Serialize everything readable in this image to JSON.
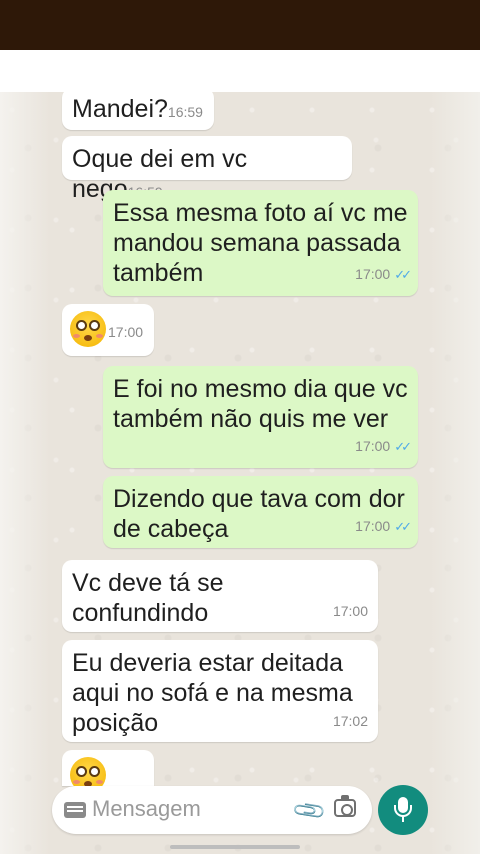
{
  "messages": [
    {
      "text": "Mandei?",
      "time": "16:59"
    },
    {
      "text": "Oque dei em vc nego",
      "time": "16:59"
    },
    {
      "line1": "Essa mesma foto aí vc me",
      "line2": "mandou semana passada",
      "line3": "também",
      "time": "17:00",
      "status": "✓✓"
    },
    {
      "emoji": "flushed-face",
      "time": "17:00"
    },
    {
      "line1": "E foi no mesmo dia que vc",
      "line2": "também não quis me ver",
      "time": "17:00",
      "status": "✓✓"
    },
    {
      "line1": "Dizendo que tava com dor",
      "line2": "de cabeça",
      "time": "17:00",
      "status": "✓✓"
    },
    {
      "line1": "Vc deve tá se",
      "line2": "confundindo",
      "time": "17:00"
    },
    {
      "line1": "Eu deveria estar deitada",
      "line2": "aqui no sofá e na mesma",
      "line3": "posição",
      "time": "17:02"
    },
    {
      "emoji": "flushed-face"
    }
  ],
  "composer": {
    "placeholder": "Mensagem"
  },
  "colors": {
    "incoming": "#ffffff",
    "outgoing": "#dcf8c6",
    "accent": "#128c7e",
    "read_ticks": "#4fa9e8"
  },
  "icons": [
    "keyboard-icon",
    "attach-icon",
    "camera-icon",
    "mic-icon"
  ]
}
